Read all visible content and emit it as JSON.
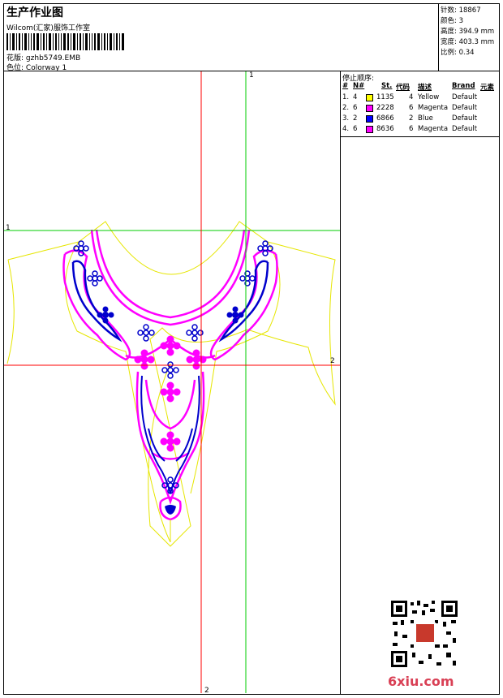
{
  "header": {
    "title": "生产作业图",
    "subtitle": "Wilcom(汇家)服饰工作室",
    "design_label": "花版:",
    "design_value": "gzhb5749.EMB",
    "colorway_label": "色位:",
    "colorway_value": "Colorway 1"
  },
  "stats": [
    {
      "label": "针数:",
      "value": "18867"
    },
    {
      "label": "颜色:",
      "value": "3"
    },
    {
      "label": "高度:",
      "value": "394.9 mm"
    },
    {
      "label": "宽度:",
      "value": "403.3 mm"
    },
    {
      "label": "比例:",
      "value": "0.34"
    }
  ],
  "stop_sequence": {
    "title": "停止顺序:",
    "headers": {
      "index": "#",
      "needle": "N#",
      "st": "St.",
      "code": "代码",
      "desc": "描述",
      "brand": "Brand",
      "element": "元素"
    },
    "rows": [
      {
        "index": "1.",
        "needle": "4",
        "color": "#ffff00",
        "code": "1135",
        "st": "4",
        "desc": "Yellow",
        "brand": "Default"
      },
      {
        "index": "2.",
        "needle": "6",
        "color": "#ff00ff",
        "code": "2228",
        "st": "6",
        "desc": "Magenta",
        "brand": "Default"
      },
      {
        "index": "3.",
        "needle": "2",
        "color": "#0000ff",
        "code": "6866",
        "st": "2",
        "desc": "Blue",
        "brand": "Default"
      },
      {
        "index": "4.",
        "needle": "6",
        "color": "#ff00ff",
        "code": "8636",
        "st": "6",
        "desc": "Magenta",
        "brand": "Default"
      }
    ]
  },
  "guides": {
    "top_label": "1",
    "left_label": "1",
    "right_label": "2",
    "bottom_label": "2"
  },
  "colors": {
    "outline": "#e6e600",
    "magenta": "#ff00ff",
    "blue": "#0000cc",
    "guide_green": "#00cc00",
    "guide_red": "#ff0000"
  },
  "watermark": "6xiu.com"
}
